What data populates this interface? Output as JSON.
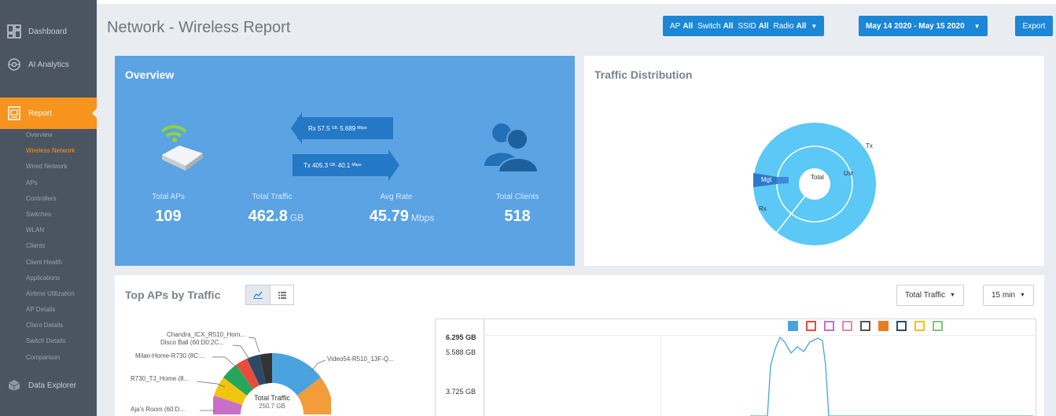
{
  "sidebar": {
    "main": [
      {
        "label": "Dashboard",
        "icon": "dashboard-icon"
      },
      {
        "label": "AI Analytics",
        "icon": "brain-icon"
      },
      {
        "label": "Report",
        "icon": "report-icon"
      },
      {
        "label": "Data Explorer",
        "icon": "data-explorer-icon"
      }
    ],
    "sub": [
      "Overview",
      "Wireless Network",
      "Wired Network",
      "APs",
      "Controllers",
      "Switches",
      "WLAN",
      "Clients",
      "Client Health",
      "Applications",
      "Airtime Utilization",
      "AP Details",
      "Client Details",
      "Switch Details",
      "Comparison"
    ],
    "current_sub": "Wireless Network"
  },
  "header": {
    "title": "Network - Wireless Report",
    "filter": {
      "ap_label": "AP",
      "ap_value": "All",
      "switch_label": "Switch",
      "switch_value": "All",
      "ssid_label": "SSID",
      "ssid_value": "All",
      "radio_label": "Radio",
      "radio_value": "All"
    },
    "date_range": "May 14 2020 - May 15 2020",
    "export_label": "Export"
  },
  "overview": {
    "title": "Overview",
    "rx_text": "Rx 57.5",
    "rx_unit": "GB,",
    "rx_rate": "5.689",
    "rx_rate_unit": "Mbps",
    "tx_text": "Tx 405.3",
    "tx_unit": "GB,",
    "tx_rate": "40.1",
    "tx_rate_unit": "Mbps",
    "stats": [
      {
        "label": "Total APs",
        "value": "109",
        "unit": ""
      },
      {
        "label": "Total Traffic",
        "value": "462.8",
        "unit": "GB"
      },
      {
        "label": "Avg Rate",
        "value": "45.79",
        "unit": "Mbps"
      },
      {
        "label": "Total Clients",
        "value": "518",
        "unit": ""
      }
    ]
  },
  "traffic_distribution": {
    "title": "Traffic Distribution",
    "labels": {
      "center": "Total",
      "tx_outer": "Tx",
      "usr": "Usr",
      "mgt": "Mgt",
      "tx_inner": "Tx",
      "rx": "Rx"
    }
  },
  "top_aps": {
    "title": "Top APs by Traffic",
    "metric_dropdown": "Total Traffic",
    "interval_dropdown": "15 min",
    "donut_center_title": "Total Traffic",
    "donut_center_value": "250.7 GB",
    "donut_labels": [
      "Chandra_ICX_R510_Hom...",
      "Disco Ball (60:D0:2C...",
      "Milan-Home-R730 (8C:...",
      "R730_TJ_Home (8...",
      "Aja's Room (60:D...",
      "Video54-R510_13F-Q..."
    ],
    "y_ticks": [
      "6.295 GB",
      "5.588 GB",
      "3.725 GB"
    ],
    "legend_colors": [
      "#4aa3df",
      "#e74c3c",
      "#c86fc9",
      "#e88aa8",
      "#555555",
      "#e67e22",
      "#2c4a66",
      "#f1c40f",
      "#7dc97d"
    ]
  },
  "colors": {
    "accent": "#f7941d",
    "primary": "#1c87d6",
    "overview_bg": "#5ba3e3",
    "sidebar_bg": "#4a5561"
  }
}
